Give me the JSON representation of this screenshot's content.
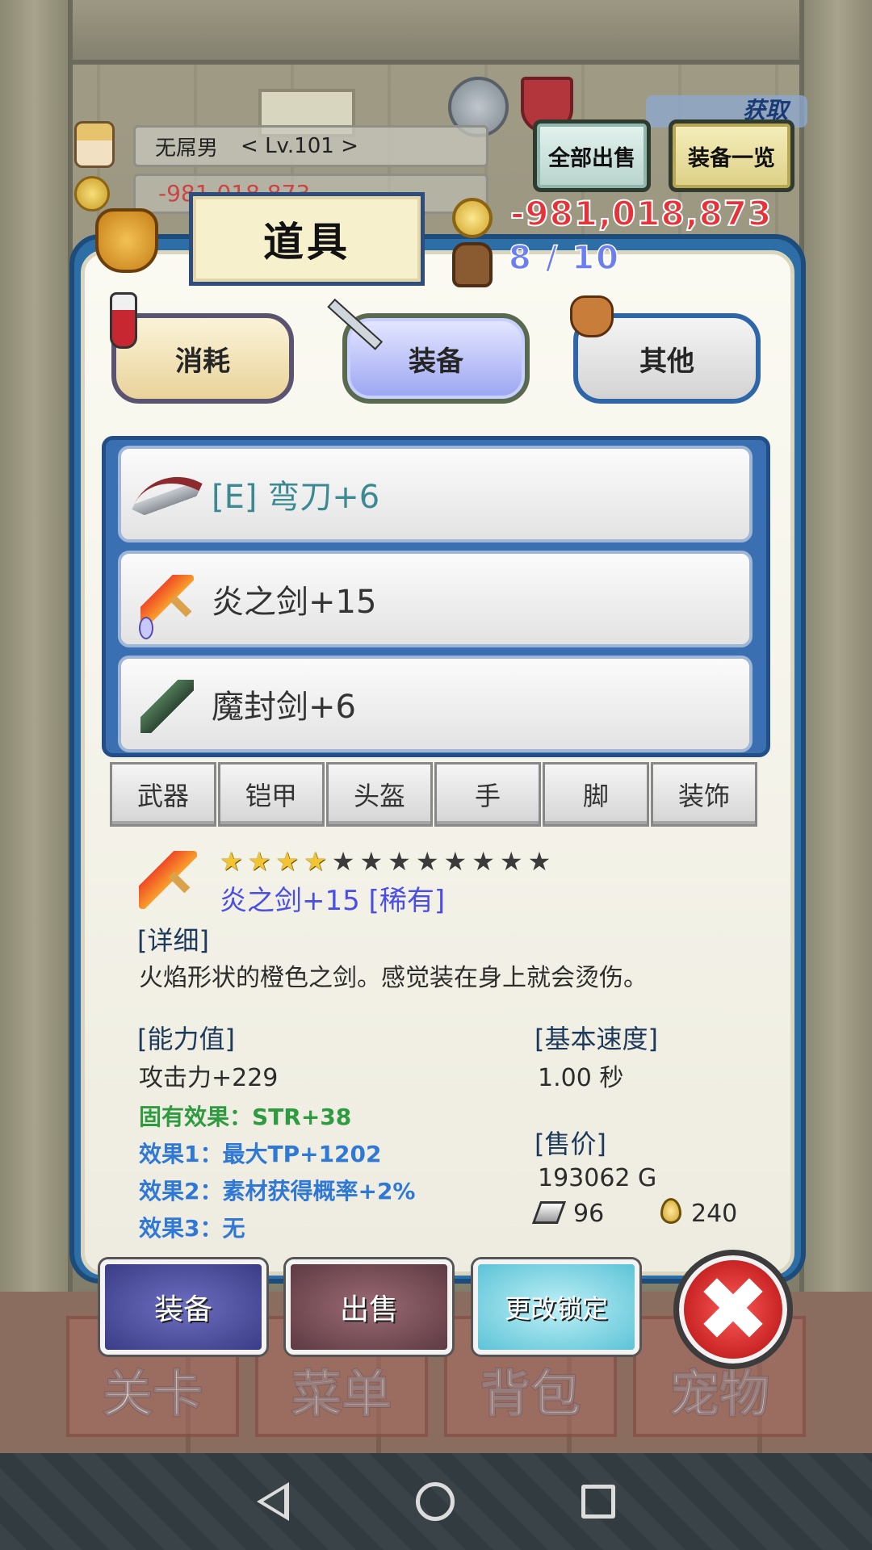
{
  "player": {
    "name": "无屌男",
    "level": "< Lv.101 >",
    "gold_ghost": "-981,018,873"
  },
  "top_buttons": {
    "sell_all": "全部出售",
    "equip_list": "装备一览",
    "get_badge": "获取"
  },
  "panel": {
    "title": "道具",
    "gold": "-981,018,873",
    "bag_count": "8 / 10"
  },
  "categories": [
    {
      "label": "消耗",
      "selected": false
    },
    {
      "label": "装备",
      "selected": true
    },
    {
      "label": "其他",
      "selected": false
    }
  ],
  "items": [
    {
      "name": "[E] 弯刀+6",
      "equipped": true,
      "icon": "scimitar-icon"
    },
    {
      "name": "炎之剑+15",
      "equipped": false,
      "icon": "flame-sword-icon"
    },
    {
      "name": "魔封剑+6",
      "equipped": false,
      "icon": "dark-sword-icon"
    }
  ],
  "slot_tabs": [
    "武器",
    "铠甲",
    "头盔",
    "手",
    "脚",
    "装饰"
  ],
  "detail": {
    "stars_filled": 4,
    "stars_total": 12,
    "name": "炎之剑+15 [稀有]",
    "desc_header": "[详细]",
    "desc": "火焰形状的橙色之剑。感觉装在身上就会烫伤。",
    "stats_header": "[能力值]",
    "attack": "攻击力+229",
    "inherent": "固有效果：STR+38",
    "effect1": "效果1：最大TP+1202",
    "effect2": "效果2：素材获得概率+2%",
    "effect3": "效果3：无",
    "speed_header": "[基本速度]",
    "speed": "1.00 秒",
    "price_header": "[售价]",
    "price": "193062 G",
    "mat_ingot": "96",
    "mat_drop": "240"
  },
  "actions": {
    "equip": "装备",
    "sell": "出售",
    "change_lock": "更改锁定",
    "close": "✖"
  },
  "game_nav": [
    "关卡",
    "菜单",
    "背包",
    "宠物"
  ],
  "colors": {
    "gold_red": "#e8323a",
    "bag_blue": "#6b7ff0",
    "rare_name": "#4a4ee8",
    "inherent_green": "#2f9b40",
    "effect_blue": "#2f78d6",
    "panel_border": "#2d6ea7"
  }
}
